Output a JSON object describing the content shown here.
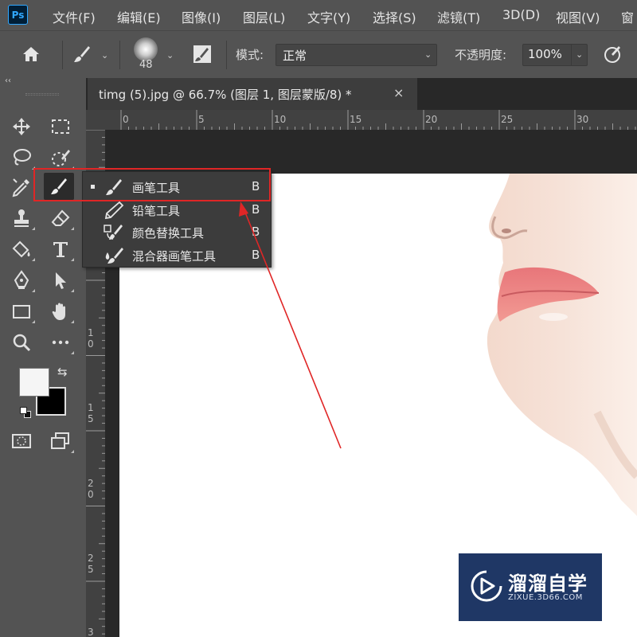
{
  "app": {
    "logo": "Ps"
  },
  "menu": [
    "文件(F)",
    "编辑(E)",
    "图像(I)",
    "图层(L)",
    "文字(Y)",
    "选择(S)",
    "滤镜(T)",
    "3D(D)",
    "视图(V)",
    "窗"
  ],
  "options": {
    "brush_size": "48",
    "mode_label": "模式:",
    "mode_value": "正常",
    "opacity_label": "不透明度:",
    "opacity_value": "100%"
  },
  "panel": {
    "collapse": "‹‹"
  },
  "document": {
    "tab_title": "timg (5).jpg @ 66.7% (图层 1, 图层蒙版/8) *",
    "close": "×"
  },
  "ruler": {
    "horizontal": [
      "0",
      "5",
      "10",
      "15",
      "20",
      "25",
      "30"
    ],
    "vertical": [
      "1\n0",
      "1\n5",
      "2\n0",
      "2\n5",
      "3"
    ]
  },
  "flyout": {
    "items": [
      {
        "name": "画笔工具",
        "key": "B",
        "selected": true,
        "icon": "brush-icon"
      },
      {
        "name": "铅笔工具",
        "key": "B",
        "selected": false,
        "icon": "pencil-icon"
      },
      {
        "name": "颜色替换工具",
        "key": "B",
        "selected": false,
        "icon": "color-replace-icon"
      },
      {
        "name": "混合器画笔工具",
        "key": "B",
        "selected": false,
        "icon": "mixer-brush-icon"
      }
    ]
  },
  "swatches": {
    "foreground": "#f5f5f5",
    "background": "#000000"
  },
  "watermark": {
    "title": "溜溜自学",
    "subtitle": "ZIXUE.3D66.COM"
  },
  "colors": {
    "annotation": "#e02626",
    "ui_bg": "#535353",
    "canvas_bg": "#282828"
  }
}
